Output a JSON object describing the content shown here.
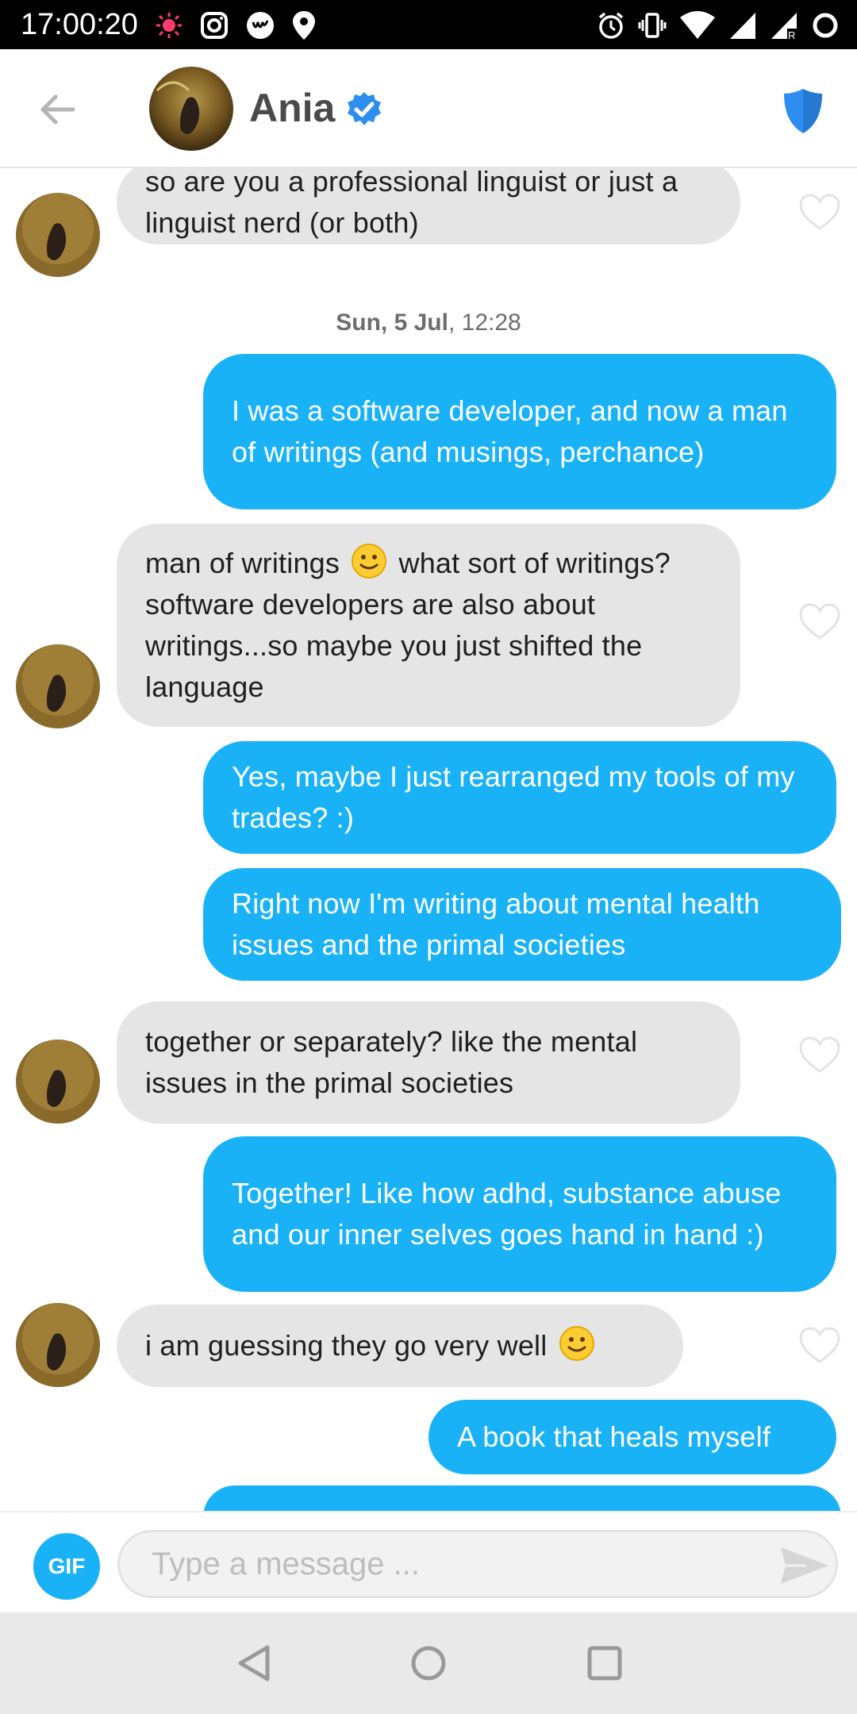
{
  "status_bar": {
    "time": "17:00:20",
    "left_icons": [
      "notification-dot-icon",
      "instagram-icon",
      "app-w-icon",
      "location-icon"
    ],
    "right_icons": [
      "alarm-icon",
      "vibrate-icon",
      "wifi-icon",
      "signal-icon",
      "signal-roaming-icon",
      "battery-ring-icon"
    ]
  },
  "header": {
    "name": "Ania",
    "verified": true,
    "accent": "#2d8ef0"
  },
  "messages": [
    {
      "side": "in",
      "text": "so are you a professional linguist or just a linguist nerd (or both)"
    },
    {
      "side": "stamp",
      "day": "Sun, 5 Jul",
      "time": ", 12:28"
    },
    {
      "side": "out",
      "text": "I was a software developer, and now a man of writings (and musings, perchance)"
    },
    {
      "side": "in",
      "text_a": "man of writings",
      "text_b": "what sort of writings? software developers are also about writings...so maybe you just shifted the language"
    },
    {
      "side": "out",
      "text": "Yes, maybe I just rearranged my tools of my trades? :)"
    },
    {
      "side": "out",
      "text": "Right now I'm writing about mental health issues and the primal societies"
    },
    {
      "side": "in",
      "text": "together or separately? like the mental issues in the primal societies"
    },
    {
      "side": "out",
      "text": "Together! Like how adhd, substance abuse and our inner selves goes hand in hand :)"
    },
    {
      "side": "in",
      "text": "i am guessing they go very well"
    },
    {
      "side": "out",
      "text": "A book that heals myself"
    }
  ],
  "composer": {
    "gif_label": "GIF",
    "placeholder": "Type a message ..."
  },
  "colors": {
    "outgoing_bubble": "#1ab2f7",
    "incoming_bubble": "#e5e5e5",
    "verified_badge": "#2d8ef0"
  }
}
